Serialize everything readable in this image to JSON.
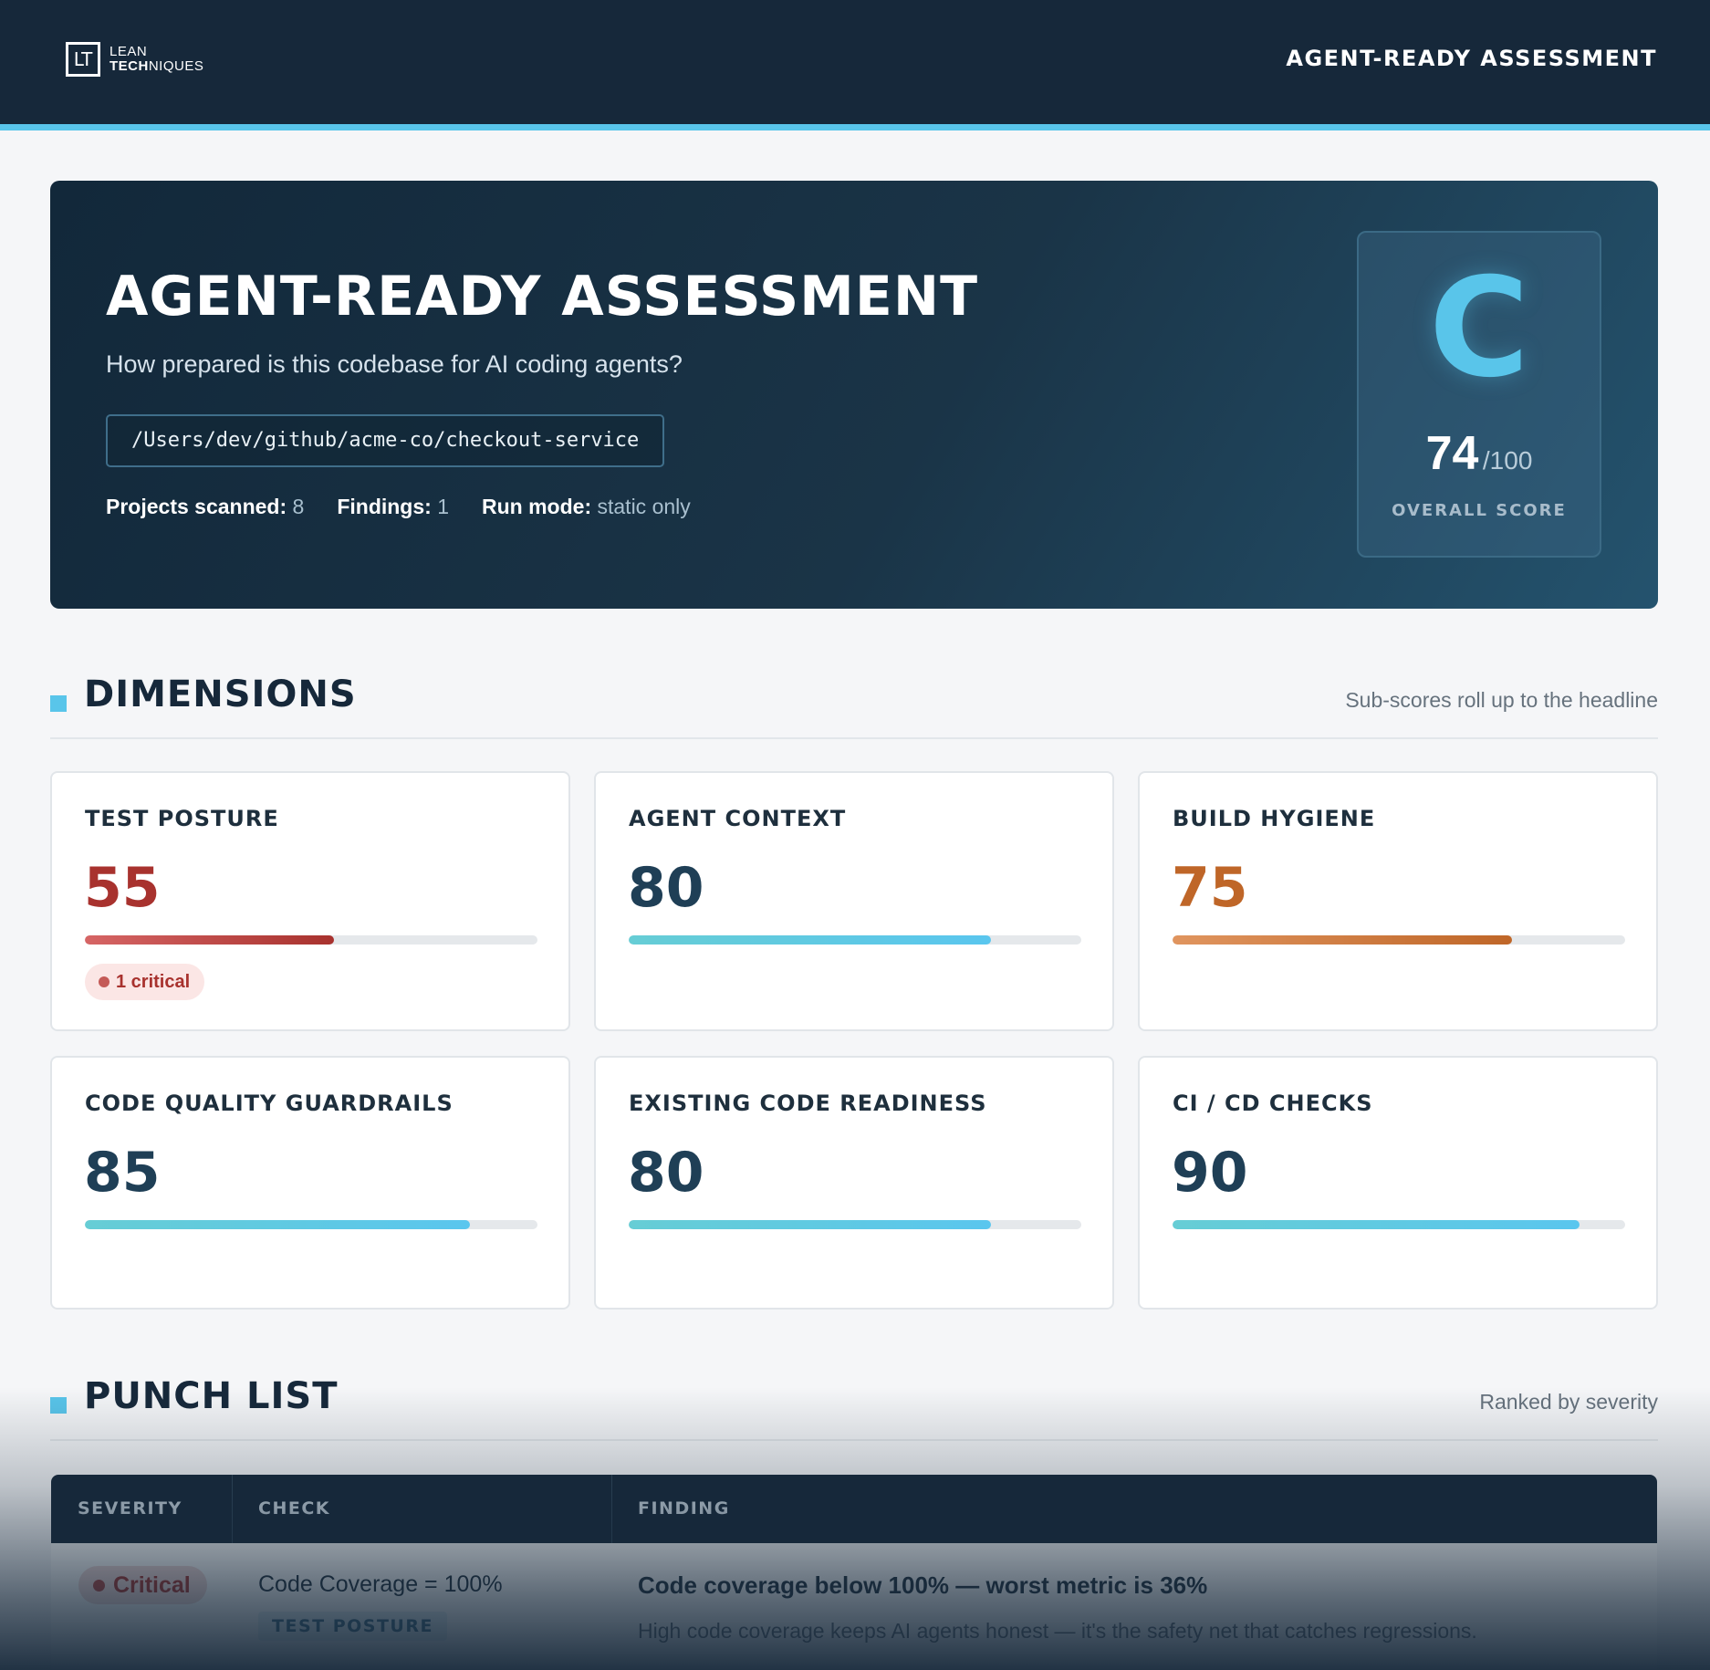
{
  "brand": {
    "logo_mark": "LT",
    "line1": "LEAN",
    "line2_bold": "TECH",
    "line2_rest": "NIQUES"
  },
  "nav": {
    "title": "AGENT-READY ASSESSMENT"
  },
  "hero": {
    "title": "AGENT-READY ASSESSMENT",
    "subtitle": "How prepared is this codebase for AI coding agents?",
    "path": "/Users/dev/github/acme-co/checkout-service",
    "meta": [
      {
        "label": "Projects scanned:",
        "value": "8"
      },
      {
        "label": "Findings:",
        "value": "1"
      },
      {
        "label": "Run mode:",
        "value": "static only"
      }
    ],
    "grade": "C",
    "score": "74",
    "score_max": "/100",
    "score_label": "OVERALL SCORE"
  },
  "dimensions": {
    "title": "DIMENSIONS",
    "note": "Sub-scores roll up to the headline",
    "cards": [
      {
        "name": "TEST POSTURE",
        "value": "55",
        "fraction": 0.55,
        "tone": "red",
        "badge": "1 critical"
      },
      {
        "name": "AGENT CONTEXT",
        "value": "80",
        "fraction": 0.8,
        "tone": "blue"
      },
      {
        "name": "BUILD HYGIENE",
        "value": "75",
        "fraction": 0.75,
        "tone": "orange"
      },
      {
        "name": "CODE QUALITY GUARDRAILS",
        "value": "85",
        "fraction": 0.85,
        "tone": "blue"
      },
      {
        "name": "EXISTING CODE READINESS",
        "value": "80",
        "fraction": 0.8,
        "tone": "blue"
      },
      {
        "name": "CI / CD CHECKS",
        "value": "90",
        "fraction": 0.9,
        "tone": "blue"
      }
    ]
  },
  "punch_list": {
    "title": "PUNCH LIST",
    "note": "Ranked by severity",
    "columns": [
      "SEVERITY",
      "CHECK",
      "FINDING"
    ],
    "rows": [
      {
        "severity": "Critical",
        "check": "Code Coverage = 100%",
        "dimension": "TEST POSTURE",
        "finding_title": "Code coverage below 100% — worst metric is 36%",
        "finding_desc": "High code coverage keeps AI agents honest — it's the safety net that catches regressions."
      }
    ]
  },
  "colors": {
    "accent": "#59c5ea",
    "navy": "#16283a",
    "critical": "#a8322e",
    "warning": "#bf6628"
  }
}
